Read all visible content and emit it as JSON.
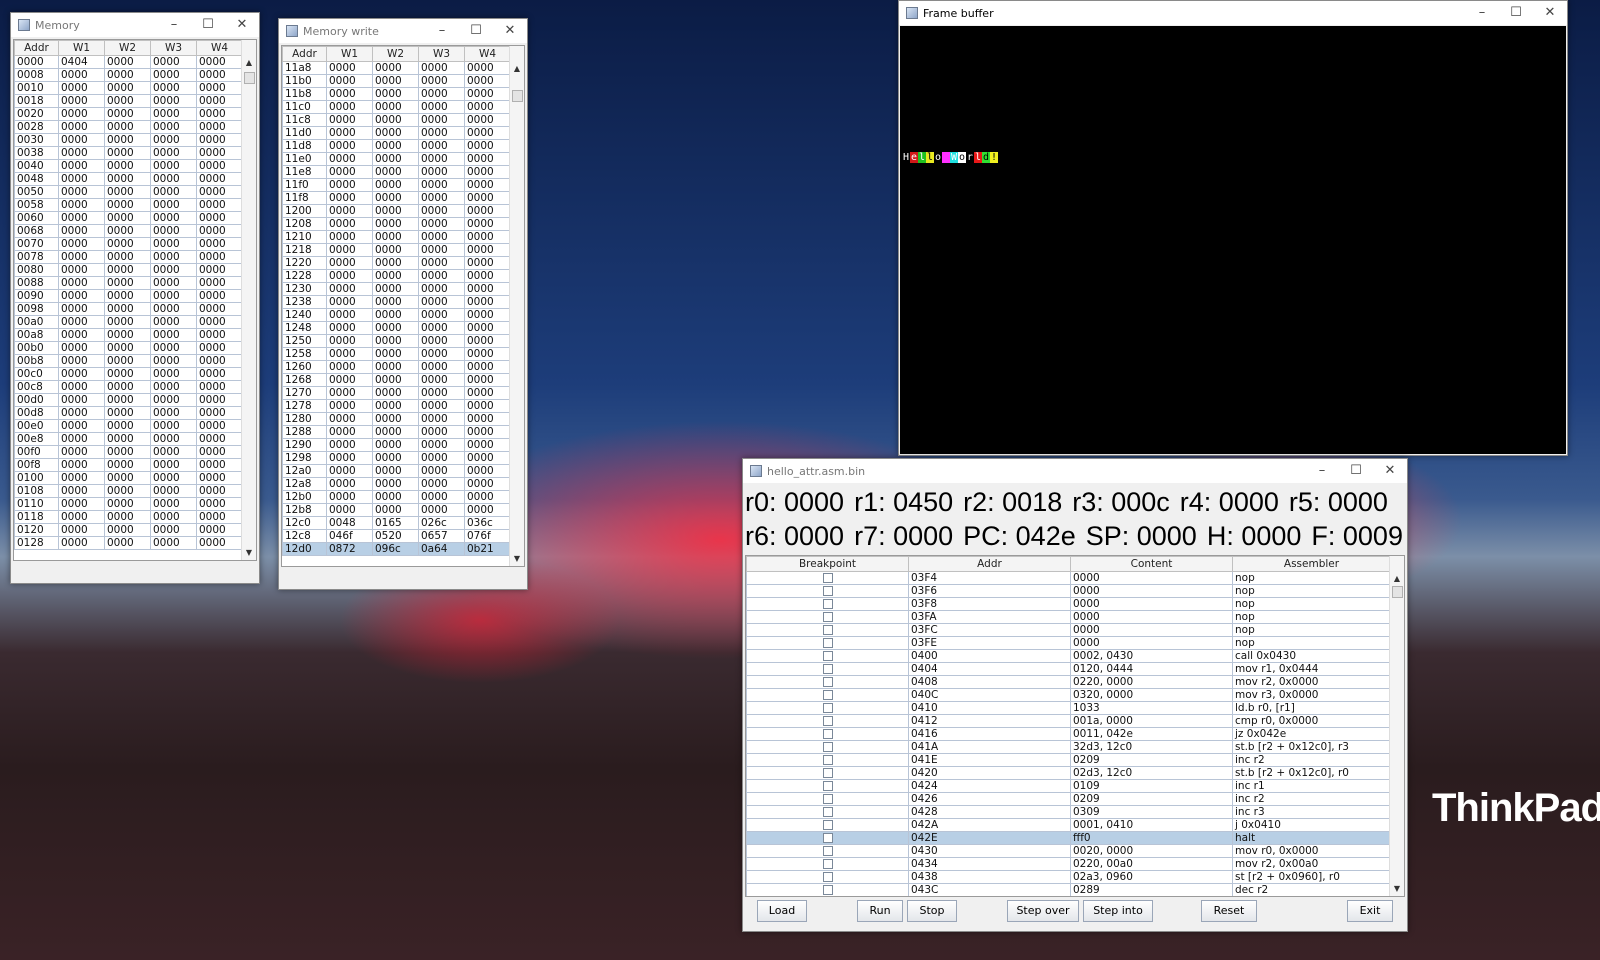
{
  "memory": {
    "title": "Memory",
    "headers": [
      "Addr",
      "W1",
      "W2",
      "W3",
      "W4"
    ],
    "rows": [
      [
        "0000",
        "0404",
        "0000",
        "0000",
        "0000"
      ],
      [
        "0008",
        "0000",
        "0000",
        "0000",
        "0000"
      ],
      [
        "0010",
        "0000",
        "0000",
        "0000",
        "0000"
      ],
      [
        "0018",
        "0000",
        "0000",
        "0000",
        "0000"
      ],
      [
        "0020",
        "0000",
        "0000",
        "0000",
        "0000"
      ],
      [
        "0028",
        "0000",
        "0000",
        "0000",
        "0000"
      ],
      [
        "0030",
        "0000",
        "0000",
        "0000",
        "0000"
      ],
      [
        "0038",
        "0000",
        "0000",
        "0000",
        "0000"
      ],
      [
        "0040",
        "0000",
        "0000",
        "0000",
        "0000"
      ],
      [
        "0048",
        "0000",
        "0000",
        "0000",
        "0000"
      ],
      [
        "0050",
        "0000",
        "0000",
        "0000",
        "0000"
      ],
      [
        "0058",
        "0000",
        "0000",
        "0000",
        "0000"
      ],
      [
        "0060",
        "0000",
        "0000",
        "0000",
        "0000"
      ],
      [
        "0068",
        "0000",
        "0000",
        "0000",
        "0000"
      ],
      [
        "0070",
        "0000",
        "0000",
        "0000",
        "0000"
      ],
      [
        "0078",
        "0000",
        "0000",
        "0000",
        "0000"
      ],
      [
        "0080",
        "0000",
        "0000",
        "0000",
        "0000"
      ],
      [
        "0088",
        "0000",
        "0000",
        "0000",
        "0000"
      ],
      [
        "0090",
        "0000",
        "0000",
        "0000",
        "0000"
      ],
      [
        "0098",
        "0000",
        "0000",
        "0000",
        "0000"
      ],
      [
        "00a0",
        "0000",
        "0000",
        "0000",
        "0000"
      ],
      [
        "00a8",
        "0000",
        "0000",
        "0000",
        "0000"
      ],
      [
        "00b0",
        "0000",
        "0000",
        "0000",
        "0000"
      ],
      [
        "00b8",
        "0000",
        "0000",
        "0000",
        "0000"
      ],
      [
        "00c0",
        "0000",
        "0000",
        "0000",
        "0000"
      ],
      [
        "00c8",
        "0000",
        "0000",
        "0000",
        "0000"
      ],
      [
        "00d0",
        "0000",
        "0000",
        "0000",
        "0000"
      ],
      [
        "00d8",
        "0000",
        "0000",
        "0000",
        "0000"
      ],
      [
        "00e0",
        "0000",
        "0000",
        "0000",
        "0000"
      ],
      [
        "00e8",
        "0000",
        "0000",
        "0000",
        "0000"
      ],
      [
        "00f0",
        "0000",
        "0000",
        "0000",
        "0000"
      ],
      [
        "00f8",
        "0000",
        "0000",
        "0000",
        "0000"
      ],
      [
        "0100",
        "0000",
        "0000",
        "0000",
        "0000"
      ],
      [
        "0108",
        "0000",
        "0000",
        "0000",
        "0000"
      ],
      [
        "0110",
        "0000",
        "0000",
        "0000",
        "0000"
      ],
      [
        "0118",
        "0000",
        "0000",
        "0000",
        "0000"
      ],
      [
        "0120",
        "0000",
        "0000",
        "0000",
        "0000"
      ],
      [
        "0128",
        "0000",
        "0000",
        "0000",
        "0000"
      ]
    ]
  },
  "memory_write": {
    "title": "Memory write",
    "headers": [
      "Addr",
      "W1",
      "W2",
      "W3",
      "W4"
    ],
    "rows": [
      [
        "11a8",
        "0000",
        "0000",
        "0000",
        "0000"
      ],
      [
        "11b0",
        "0000",
        "0000",
        "0000",
        "0000"
      ],
      [
        "11b8",
        "0000",
        "0000",
        "0000",
        "0000"
      ],
      [
        "11c0",
        "0000",
        "0000",
        "0000",
        "0000"
      ],
      [
        "11c8",
        "0000",
        "0000",
        "0000",
        "0000"
      ],
      [
        "11d0",
        "0000",
        "0000",
        "0000",
        "0000"
      ],
      [
        "11d8",
        "0000",
        "0000",
        "0000",
        "0000"
      ],
      [
        "11e0",
        "0000",
        "0000",
        "0000",
        "0000"
      ],
      [
        "11e8",
        "0000",
        "0000",
        "0000",
        "0000"
      ],
      [
        "11f0",
        "0000",
        "0000",
        "0000",
        "0000"
      ],
      [
        "11f8",
        "0000",
        "0000",
        "0000",
        "0000"
      ],
      [
        "1200",
        "0000",
        "0000",
        "0000",
        "0000"
      ],
      [
        "1208",
        "0000",
        "0000",
        "0000",
        "0000"
      ],
      [
        "1210",
        "0000",
        "0000",
        "0000",
        "0000"
      ],
      [
        "1218",
        "0000",
        "0000",
        "0000",
        "0000"
      ],
      [
        "1220",
        "0000",
        "0000",
        "0000",
        "0000"
      ],
      [
        "1228",
        "0000",
        "0000",
        "0000",
        "0000"
      ],
      [
        "1230",
        "0000",
        "0000",
        "0000",
        "0000"
      ],
      [
        "1238",
        "0000",
        "0000",
        "0000",
        "0000"
      ],
      [
        "1240",
        "0000",
        "0000",
        "0000",
        "0000"
      ],
      [
        "1248",
        "0000",
        "0000",
        "0000",
        "0000"
      ],
      [
        "1250",
        "0000",
        "0000",
        "0000",
        "0000"
      ],
      [
        "1258",
        "0000",
        "0000",
        "0000",
        "0000"
      ],
      [
        "1260",
        "0000",
        "0000",
        "0000",
        "0000"
      ],
      [
        "1268",
        "0000",
        "0000",
        "0000",
        "0000"
      ],
      [
        "1270",
        "0000",
        "0000",
        "0000",
        "0000"
      ],
      [
        "1278",
        "0000",
        "0000",
        "0000",
        "0000"
      ],
      [
        "1280",
        "0000",
        "0000",
        "0000",
        "0000"
      ],
      [
        "1288",
        "0000",
        "0000",
        "0000",
        "0000"
      ],
      [
        "1290",
        "0000",
        "0000",
        "0000",
        "0000"
      ],
      [
        "1298",
        "0000",
        "0000",
        "0000",
        "0000"
      ],
      [
        "12a0",
        "0000",
        "0000",
        "0000",
        "0000"
      ],
      [
        "12a8",
        "0000",
        "0000",
        "0000",
        "0000"
      ],
      [
        "12b0",
        "0000",
        "0000",
        "0000",
        "0000"
      ],
      [
        "12b8",
        "0000",
        "0000",
        "0000",
        "0000"
      ],
      [
        "12c0",
        "0048",
        "0165",
        "026c",
        "036c"
      ],
      [
        "12c8",
        "046f",
        "0520",
        "0657",
        "076f"
      ],
      [
        "12d0",
        "0872",
        "096c",
        "0a64",
        "0b21"
      ]
    ],
    "selected_row": 37
  },
  "frame_buffer": {
    "title": "Frame buffer",
    "cells": [
      {
        "ch": "H",
        "fg": "#ffffff",
        "bg": "#000000"
      },
      {
        "ch": "e",
        "fg": "#ffffff",
        "bg": "#d01818"
      },
      {
        "ch": "l",
        "fg": "#ffffff",
        "bg": "#20c020"
      },
      {
        "ch": "l",
        "fg": "#000000",
        "bg": "#e8e820"
      },
      {
        "ch": "o",
        "fg": "#ffffff",
        "bg": "#000000"
      },
      {
        "ch": " ",
        "fg": "#ffffff",
        "bg": "#ff30ff"
      },
      {
        "ch": "W",
        "fg": "#ffffff",
        "bg": "#20e0e0"
      },
      {
        "ch": "o",
        "fg": "#000000",
        "bg": "#ffffff"
      },
      {
        "ch": "r",
        "fg": "#ffffff",
        "bg": "#000000"
      },
      {
        "ch": "l",
        "fg": "#ffffff",
        "bg": "#e81818"
      },
      {
        "ch": "d",
        "fg": "#000000",
        "bg": "#30e030"
      },
      {
        "ch": "!",
        "fg": "#000000",
        "bg": "#f0f020"
      }
    ]
  },
  "debugger": {
    "title": "hello_attr.asm.bin",
    "registers_line1": [
      "r0: 0000",
      "r1: 0450",
      "r2: 0018",
      "r3: 000c",
      "r4: 0000",
      "r5: 0000"
    ],
    "registers_line2": [
      "r6: 0000",
      "r7: 0000",
      "PC: 042e",
      "SP: 0000",
      "H: 0000",
      "F: 0009"
    ],
    "headers": [
      "Breakpoint",
      "Addr",
      "Content",
      "Assembler"
    ],
    "rows": [
      [
        "03F4",
        "0000",
        "nop"
      ],
      [
        "03F6",
        "0000",
        "nop"
      ],
      [
        "03F8",
        "0000",
        "nop"
      ],
      [
        "03FA",
        "0000",
        "nop"
      ],
      [
        "03FC",
        "0000",
        "nop"
      ],
      [
        "03FE",
        "0000",
        "nop"
      ],
      [
        "0400",
        "0002, 0430",
        "call 0x0430"
      ],
      [
        "0404",
        "0120, 0444",
        "mov r1, 0x0444"
      ],
      [
        "0408",
        "0220, 0000",
        "mov r2, 0x0000"
      ],
      [
        "040C",
        "0320, 0000",
        "mov r3, 0x0000"
      ],
      [
        "0410",
        "1033",
        "ld.b r0, [r1]"
      ],
      [
        "0412",
        "001a, 0000",
        "cmp r0, 0x0000"
      ],
      [
        "0416",
        "0011, 042e",
        "jz 0x042e"
      ],
      [
        "041A",
        "32d3, 12c0",
        "st.b [r2 + 0x12c0], r3"
      ],
      [
        "041E",
        "0209",
        "inc r2"
      ],
      [
        "0420",
        "02d3, 12c0",
        "st.b [r2 + 0x12c0], r0"
      ],
      [
        "0424",
        "0109",
        "inc r1"
      ],
      [
        "0426",
        "0209",
        "inc r2"
      ],
      [
        "0428",
        "0309",
        "inc r3"
      ],
      [
        "042A",
        "0001, 0410",
        "j 0x0410"
      ],
      [
        "042E",
        "fff0",
        "halt"
      ],
      [
        "0430",
        "0020, 0000",
        "mov r0, 0x0000"
      ],
      [
        "0434",
        "0220, 00a0",
        "mov r2, 0x00a0"
      ],
      [
        "0438",
        "02a3, 0960",
        "st [r2 + 0x0960], r0"
      ],
      [
        "043C",
        "0289",
        "dec r2"
      ]
    ],
    "selected_row": 20,
    "buttons": {
      "load": "Load",
      "run": "Run",
      "stop": "Stop",
      "step_over": "Step over",
      "step_into": "Step into",
      "reset": "Reset",
      "exit": "Exit"
    }
  },
  "desktop": {
    "brand_text": "ThinkPad",
    "brand_x": "X"
  }
}
